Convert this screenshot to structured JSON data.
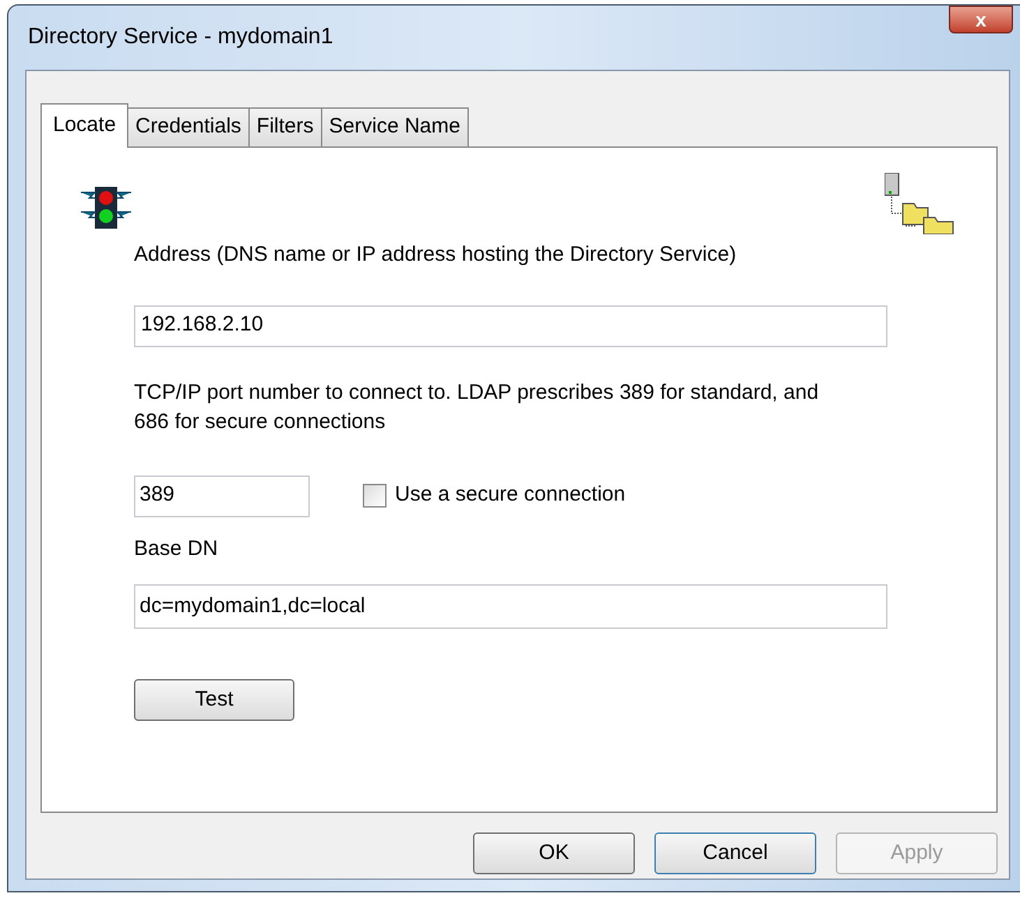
{
  "window": {
    "title": "Directory Service - mydomain1",
    "close": "x"
  },
  "tabs": [
    {
      "label": "Locate",
      "selected": true
    },
    {
      "label": "Credentials",
      "selected": false
    },
    {
      "label": "Filters",
      "selected": false
    },
    {
      "label": "Service Name",
      "selected": false
    }
  ],
  "address": {
    "label": "Address (DNS name or IP address hosting the Directory Service)",
    "value": "192.168.2.10"
  },
  "port": {
    "label": "TCP/IP port number to connect to. LDAP prescribes 389 for standard, and 686 for secure connections",
    "value": "389"
  },
  "secure": {
    "label": "Use a secure connection",
    "checked": false
  },
  "base_dn": {
    "label": "Base DN",
    "value": "dc=mydomain1,dc=local"
  },
  "test_button": "Test",
  "buttons": [
    {
      "label": "OK",
      "disabled": false,
      "focused": false
    },
    {
      "label": "Cancel",
      "disabled": false,
      "focused": true
    },
    {
      "label": "Apply",
      "disabled": true,
      "focused": false
    }
  ]
}
